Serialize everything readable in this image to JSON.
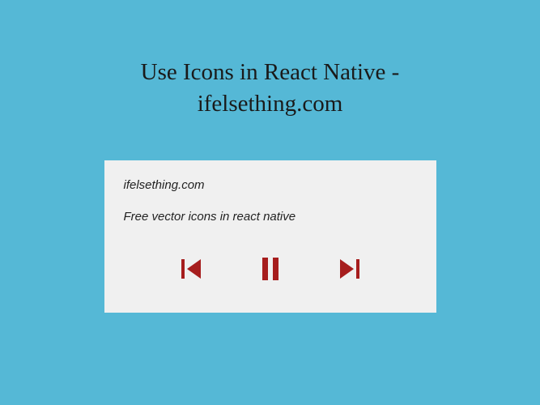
{
  "heading": {
    "line1": "Use Icons in React Native -",
    "line2": "ifelsething.com"
  },
  "card": {
    "brand": "ifelsething.com",
    "subtitle": "Free vector icons in react native"
  },
  "icons": {
    "prev": "skip-previous-icon",
    "pause": "pause-icon",
    "next": "skip-next-icon",
    "color": "#a61d1d"
  }
}
